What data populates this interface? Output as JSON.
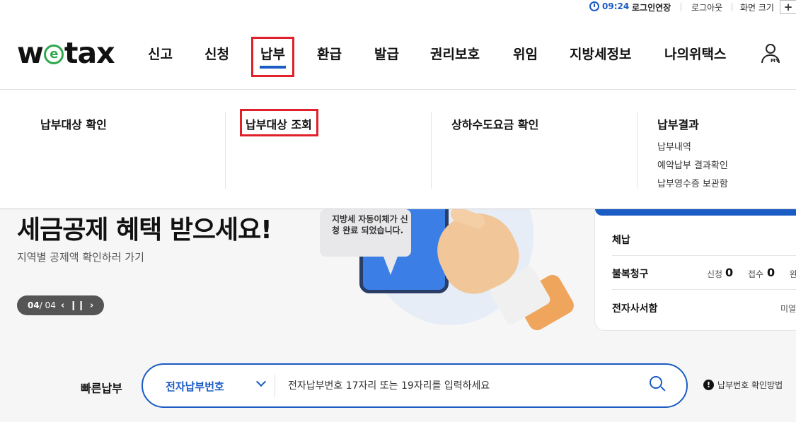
{
  "util": {
    "timer": "09:24",
    "extend": "로그인연장",
    "logout": "로그아웃",
    "screen_size": "화면 크기",
    "size_plus": "+"
  },
  "logo": {
    "left": "w",
    "e": "e",
    "right": "tax"
  },
  "gnb": [
    "신고",
    "신청",
    "납부",
    "환급",
    "발급",
    "권리보호",
    "위임",
    "지방세정보",
    "나의위택스"
  ],
  "gnb_active": "납부",
  "my_label": "MY",
  "mega": {
    "columns": [
      "납부대상 확인",
      "납부대상 조회",
      "상하수도요금 확인",
      "납부결과"
    ],
    "result_items": [
      "납부내역",
      "예약납부 결과확인",
      "납부영수증 보관함"
    ]
  },
  "hero": {
    "title": "세금공제 혜택 받으세요!",
    "desc": "지역별 공제액 확인하러 가기",
    "page_current": "04",
    "page_total": "/ 04",
    "bubble_text": "지방세 자동이체가 신청 완료 되었습니다."
  },
  "panel": {
    "row1": "체납",
    "row2": "불복청구",
    "row3": "전자사서함",
    "apply_label": "신청",
    "apply_value": "0",
    "receive_label": "접수",
    "receive_value": "0",
    "extra": "완",
    "unread": "미열"
  },
  "quick": {
    "label": "빠른납부",
    "select_value": "전자납부번호",
    "placeholder": "전자납부번호 17자리 또는 19자리를 입력하세요",
    "help": "납부번호 확인방법",
    "help_icon": "!"
  }
}
